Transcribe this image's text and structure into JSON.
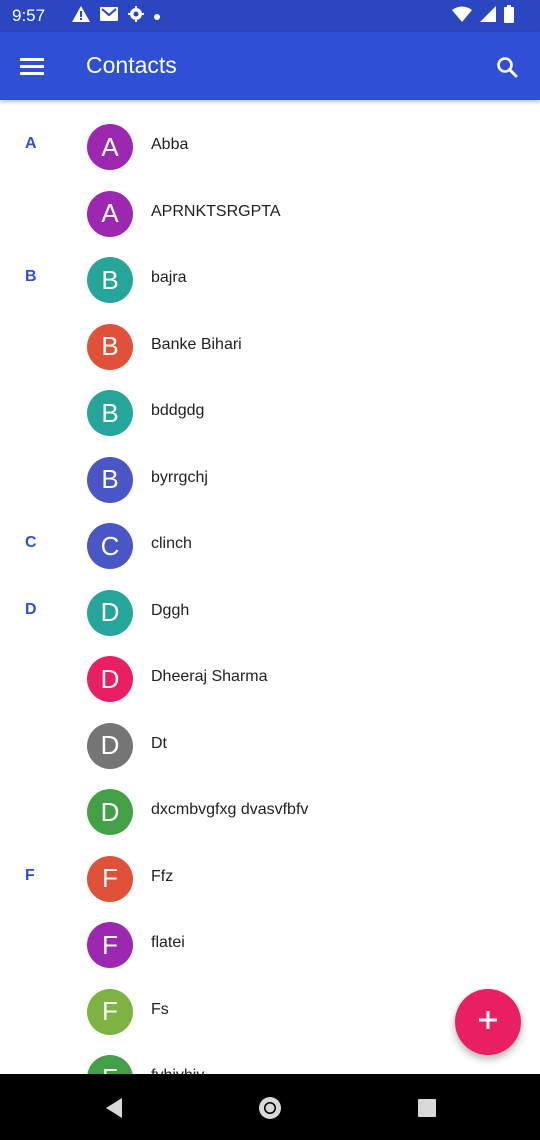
{
  "status_bar": {
    "time": "9:57"
  },
  "app_bar": {
    "title": "Contacts",
    "color": "#2f4fd6"
  },
  "contacts": [
    {
      "section": "A",
      "initial": "A",
      "name": "Abba",
      "color": "#9c27b0"
    },
    {
      "section": "",
      "initial": "A",
      "name": "APRNKTSRGPTA",
      "color": "#9c27b0"
    },
    {
      "section": "B",
      "initial": "B",
      "name": "bajra",
      "color": "#26a69a"
    },
    {
      "section": "",
      "initial": "B",
      "name": "Banke Bihari",
      "color": "#e0513a"
    },
    {
      "section": "",
      "initial": "B",
      "name": "bddgdg",
      "color": "#26a69a"
    },
    {
      "section": "",
      "initial": "B",
      "name": "byrrgchj",
      "color": "#4a55c6"
    },
    {
      "section": "C",
      "initial": "C",
      "name": "clinch",
      "color": "#4a55c6"
    },
    {
      "section": "D",
      "initial": "D",
      "name": "Dggh",
      "color": "#26a69a"
    },
    {
      "section": "",
      "initial": "D",
      "name": "Dheeraj Sharma",
      "color": "#e91e63"
    },
    {
      "section": "",
      "initial": "D",
      "name": "Dt",
      "color": "#757575"
    },
    {
      "section": "",
      "initial": "D",
      "name": "dxcmbvgfxg dvasvfbfv",
      "color": "#43a047"
    },
    {
      "section": "F",
      "initial": "F",
      "name": "Ffz",
      "color": "#e0513a"
    },
    {
      "section": "",
      "initial": "F",
      "name": "flatei",
      "color": "#9c27b0"
    },
    {
      "section": "",
      "initial": "F",
      "name": "Fs",
      "color": "#7cb342"
    },
    {
      "section": "",
      "initial": "F",
      "name": "fvhjvhjv",
      "color": "#43a047"
    }
  ],
  "fab": {
    "icon": "plus-icon",
    "color": "#e91e63"
  },
  "nav": {
    "back": "back-icon",
    "home": "home-icon",
    "recents": "recents-icon"
  }
}
